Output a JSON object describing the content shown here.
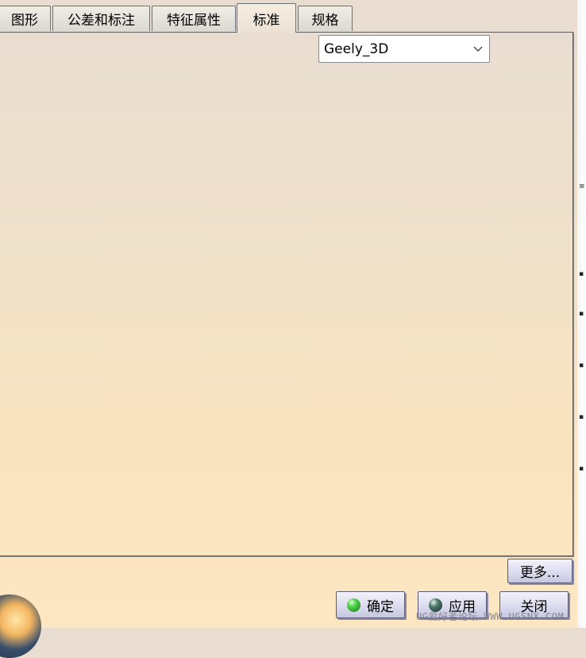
{
  "tabs": [
    {
      "label": "图形"
    },
    {
      "label": "公差和标注"
    },
    {
      "label": "特征属性"
    },
    {
      "label": "标准",
      "active": true
    },
    {
      "label": "规格"
    }
  ],
  "standard_select": {
    "value": "Geely_3D"
  },
  "buttons": {
    "more": "更多...",
    "ok": "确定",
    "apply": "应用",
    "close": "关闭"
  },
  "watermark": "UG爱好者论坛 WWW.UGSNX.COM",
  "icons": {
    "ok": "green-ball-icon",
    "apply": "dark-ball-icon",
    "dropdown": "chevron-down-icon"
  },
  "colors": {
    "panel_top": "#e9ddd2",
    "panel_bottom": "#fce6c2",
    "button_face": "#dcdcef"
  }
}
